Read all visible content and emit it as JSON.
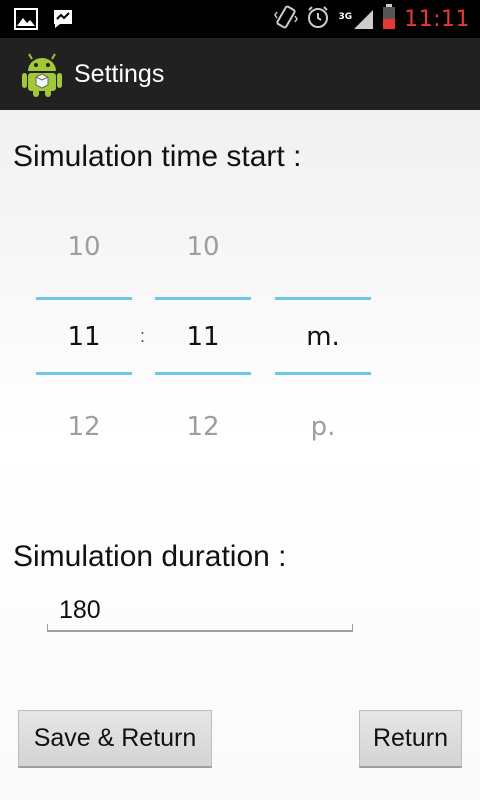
{
  "status_bar": {
    "time": "11:11",
    "network": "3G",
    "left_icons": [
      "image-icon",
      "messenger-icon"
    ],
    "right_icons": [
      "vibrate-icon",
      "alarm-icon",
      "signal-icon",
      "battery-icon"
    ],
    "clock_color": "#e53935"
  },
  "action_bar": {
    "title": "Settings",
    "icon": "android-app-icon"
  },
  "time_start": {
    "label": "Simulation time start :",
    "hour": {
      "prev": "10",
      "current": "11",
      "next": "12"
    },
    "separator": ":",
    "minute": {
      "prev": "10",
      "current": "11",
      "next": "12"
    },
    "ampm": {
      "prev": "",
      "current": "m.",
      "next": "p."
    },
    "accent_color": "#6ec6e8"
  },
  "duration": {
    "label": "Simulation duration :",
    "value": "180"
  },
  "buttons": {
    "save_return": "Save & Return",
    "return": "Return"
  }
}
